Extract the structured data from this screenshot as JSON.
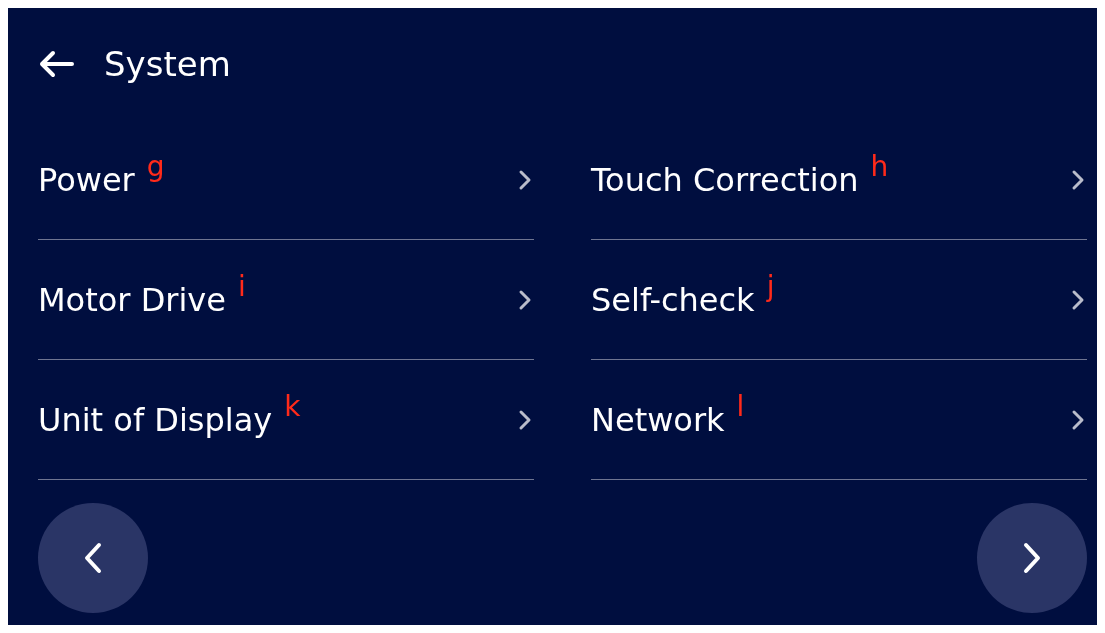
{
  "header": {
    "title": "System"
  },
  "items": [
    {
      "label": "Power",
      "mark": "g"
    },
    {
      "label": "Touch Correction",
      "mark": "h"
    },
    {
      "label": "Motor Drive",
      "mark": "i"
    },
    {
      "label": "Self-check",
      "mark": "j"
    },
    {
      "label": "Unit of Display",
      "mark": "k"
    },
    {
      "label": "Network",
      "mark": "l"
    }
  ]
}
